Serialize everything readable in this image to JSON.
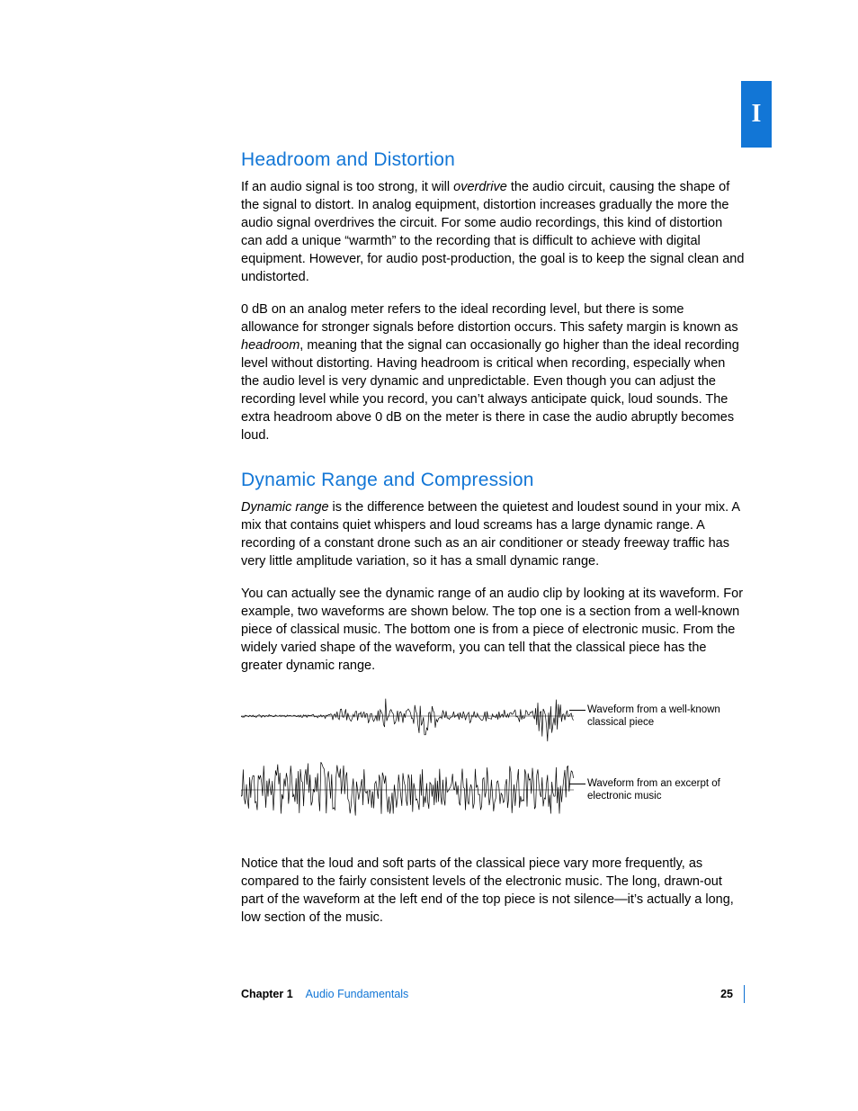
{
  "tab": "I",
  "section1": {
    "heading": "Headroom and Distortion",
    "p1a": "If an audio signal is too strong, it will ",
    "p1_em": "overdrive",
    "p1b": " the audio circuit, causing the shape of the signal to distort. In analog equipment, distortion increases gradually the more the audio signal overdrives the circuit. For some audio recordings, this kind of distortion can add a unique “warmth” to the recording that is difficult to achieve with digital equipment. However, for audio post-production, the goal is to keep the signal clean and undistorted.",
    "p2a": "0 dB on an analog meter refers to the ideal recording level, but there is some allowance for stronger signals before distortion occurs. This safety margin is known as ",
    "p2_em": "headroom",
    "p2b": ", meaning that the signal can occasionally go higher than the ideal recording level without distorting. Having headroom is critical when recording, especially when the audio level is very dynamic and unpredictable. Even though you can adjust the recording level while you record, you can’t always anticipate quick, loud sounds. The extra headroom above 0 dB on the meter is there in case the audio abruptly becomes loud."
  },
  "section2": {
    "heading": "Dynamic Range and Compression",
    "p1_em": "Dynamic range",
    "p1a": " is the difference between the quietest and loudest sound in your mix. A mix that contains quiet whispers and loud screams has a large dynamic range. A recording of a constant drone such as an air conditioner or steady freeway traffic has very little amplitude variation, so it has a small dynamic range.",
    "p2": "You can actually see the dynamic range of an audio clip by looking at its waveform. For example, two waveforms are shown below. The top one is a section from a well-known piece of classical music. The bottom one is from a piece of electronic music. From the widely varied shape of the waveform, you can tell that the classical piece has the greater dynamic range.",
    "caption1": "Waveform from a well-known classical piece",
    "caption2": "Waveform from an excerpt of electronic music",
    "p3": "Notice that the loud and soft parts of the classical piece vary more frequently, as compared to the fairly consistent levels of the electronic music. The long, drawn-out part of the waveform at the left end of the top piece is not silence—it’s actually a long, low section of the music."
  },
  "footer": {
    "chapter": "Chapter 1",
    "title": "Audio Fundamentals",
    "page": "25"
  }
}
